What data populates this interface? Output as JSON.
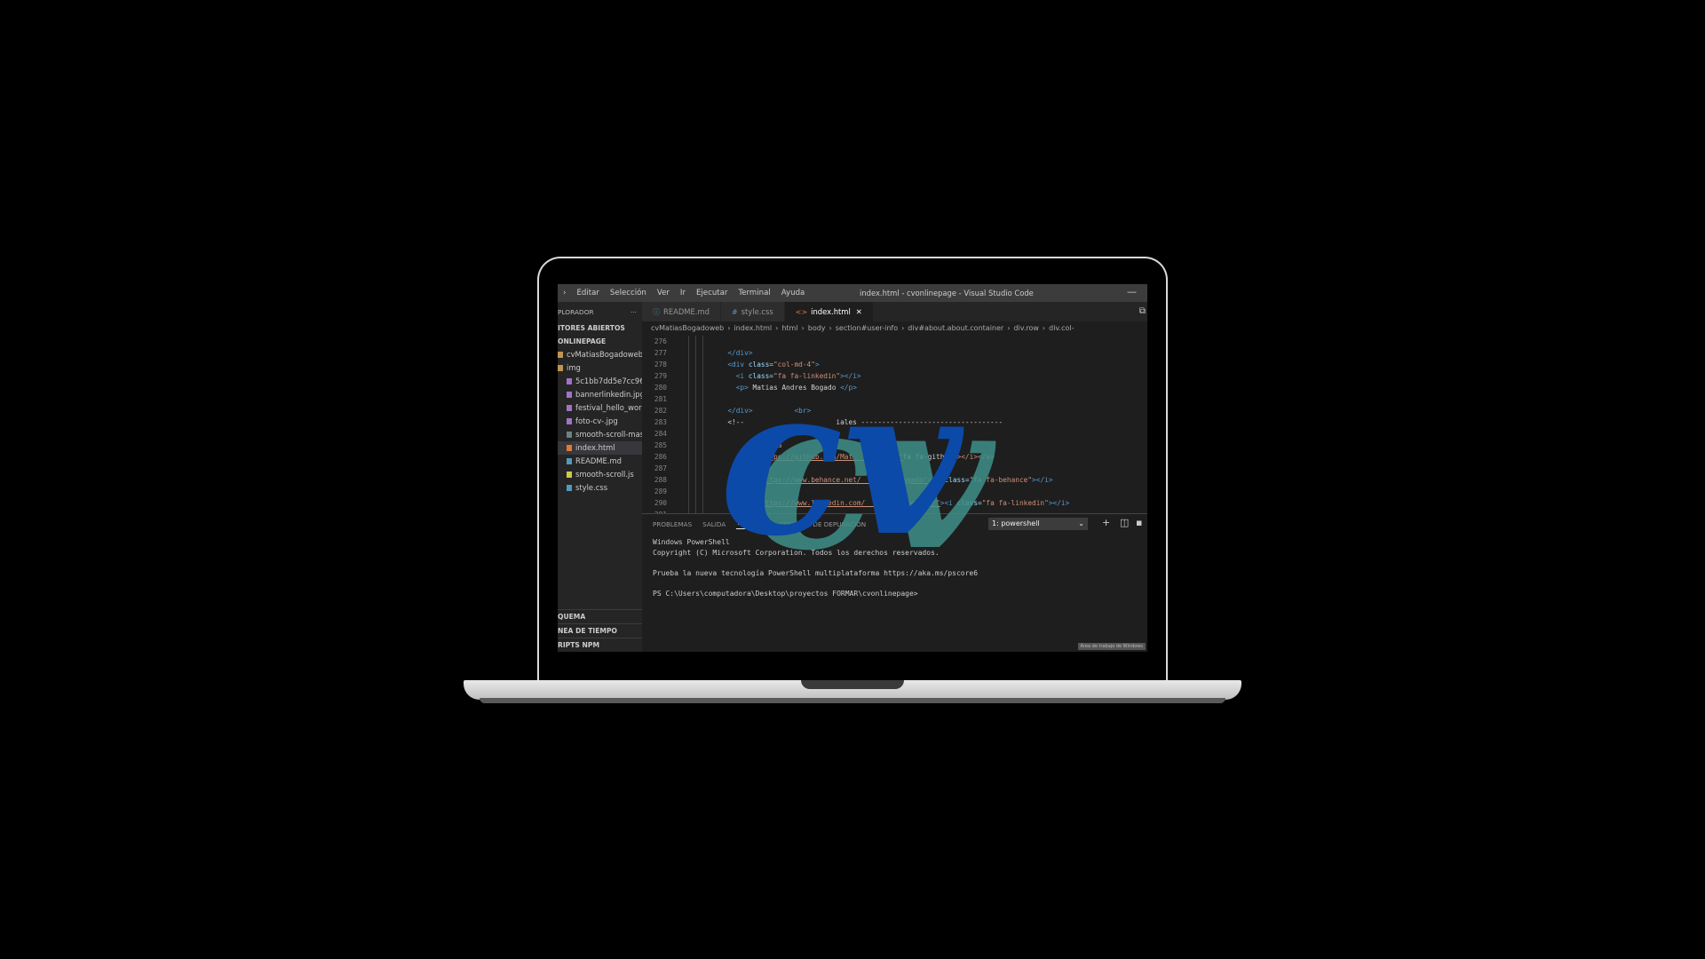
{
  "menu": [
    "Editar",
    "Selección",
    "Ver",
    "Ir",
    "Ejecutar",
    "Terminal",
    "Ayuda"
  ],
  "window_title": "index.html - cvonlinepage - Visual Studio Code",
  "sidebar": {
    "explorer_label": "PLORADOR",
    "more": "···",
    "open_editors": "ITORES ABIERTOS",
    "project": "ONLINEPAGE",
    "items": [
      {
        "label": "cvMatiasBogadoweb",
        "icon": "folder"
      },
      {
        "label": "img",
        "icon": "folder"
      },
      {
        "label": "5c1bb7dd5e7cc96...",
        "icon": "image"
      },
      {
        "label": "bannerlinkedin.jpg",
        "icon": "image"
      },
      {
        "label": "festival_hello_worl...",
        "icon": "image"
      },
      {
        "label": "foto-cv-.jpg",
        "icon": "image"
      },
      {
        "label": "smooth-scroll-mas...",
        "icon": "file"
      },
      {
        "label": "index.html",
        "icon": "html"
      },
      {
        "label": "README.md",
        "icon": "md"
      },
      {
        "label": "smooth-scroll.js",
        "icon": "js"
      },
      {
        "label": "style.css",
        "icon": "css"
      }
    ],
    "bottom_sections": [
      "QUEMA",
      "NEA DE TIEMPO",
      "RIPTS NPM"
    ]
  },
  "tabs": [
    {
      "label": "README.md",
      "icon": "ⓘ",
      "icon_color": "#519aba"
    },
    {
      "label": "style.css",
      "icon": "#",
      "icon_color": "#519aba"
    },
    {
      "label": "index.html",
      "icon": "<>",
      "icon_color": "#e37933",
      "active": true,
      "close": "✕"
    }
  ],
  "breadcrumb": [
    "cvMatiasBogadoweb",
    "index.html",
    "html",
    "body",
    "section#user-info",
    "div#about.about.container",
    "div.row",
    "div.col-"
  ],
  "code_lines": [
    {
      "n": "276",
      "t": ""
    },
    {
      "n": "277",
      "t": "            </div>"
    },
    {
      "n": "278",
      "t": "            <div class=\"col-md-4\">"
    },
    {
      "n": "279",
      "t": "              <i class=\"fa fa-linkedin\"></i>"
    },
    {
      "n": "280",
      "t": "              <p> Matias Andres Bogado </p>"
    },
    {
      "n": "281",
      "t": ""
    },
    {
      "n": "282",
      "t": "            </div>          <br>"
    },
    {
      "n": "283",
      "t": "            <!--                      iales ----------------------------------"
    },
    {
      "n": "284",
      "t": ""
    },
    {
      "n": "285",
      "t": "                  =\"socia"
    },
    {
      "n": "286",
      "t": "                  =\"https://github.com/Mat          =\"fa fa-github\"></i></a>"
    },
    {
      "n": "287",
      "t": ""
    },
    {
      "n": "288",
      "t": "                ef=\"https://www.behance.net/          ogado\"><i class=\"fa fa-behance\"></i>"
    },
    {
      "n": "289",
      "t": ""
    },
    {
      "n": "290",
      "t": "                ef=\"https://www.linkedin.com/          bogado/\"><i class=\"fa fa-linkedin\"></i>"
    },
    {
      "n": "291",
      "t": ""
    },
    {
      "n": "292",
      "t": "                     //youtu.be/f2QdDqr         class=\"fa fa-youtube-play\"></i></a>"
    },
    {
      "n": "293",
      "t": ""
    },
    {
      "n": "294",
      "t": ""
    },
    {
      "n": "295",
      "t": "          </div>"
    }
  ],
  "panel": {
    "tabs": [
      "PROBLEMAS",
      "SALIDA",
      "TERMINAL",
      "CONSOLA DE DEPURACIÓN"
    ],
    "active_tab": "TERMINAL",
    "terminal_select": "1: powershell",
    "plus": "+",
    "terminal_lines": [
      "Windows PowerShell",
      "Copyright (C) Microsoft Corporation. Todos los derechos reservados.",
      "",
      "Prueba la nueva tecnología PowerShell multiplataforma https://aka.ms/pscore6",
      "",
      "PS C:\\Users\\computadora\\Desktop\\proyectos FORMAR\\cvonlinepage>"
    ],
    "watermark": "Área de trabajo de Windows"
  },
  "logo_text": "cv",
  "colors": {
    "logo_blue": "#0b4aa8",
    "logo_teal": "#3f8f8a"
  }
}
